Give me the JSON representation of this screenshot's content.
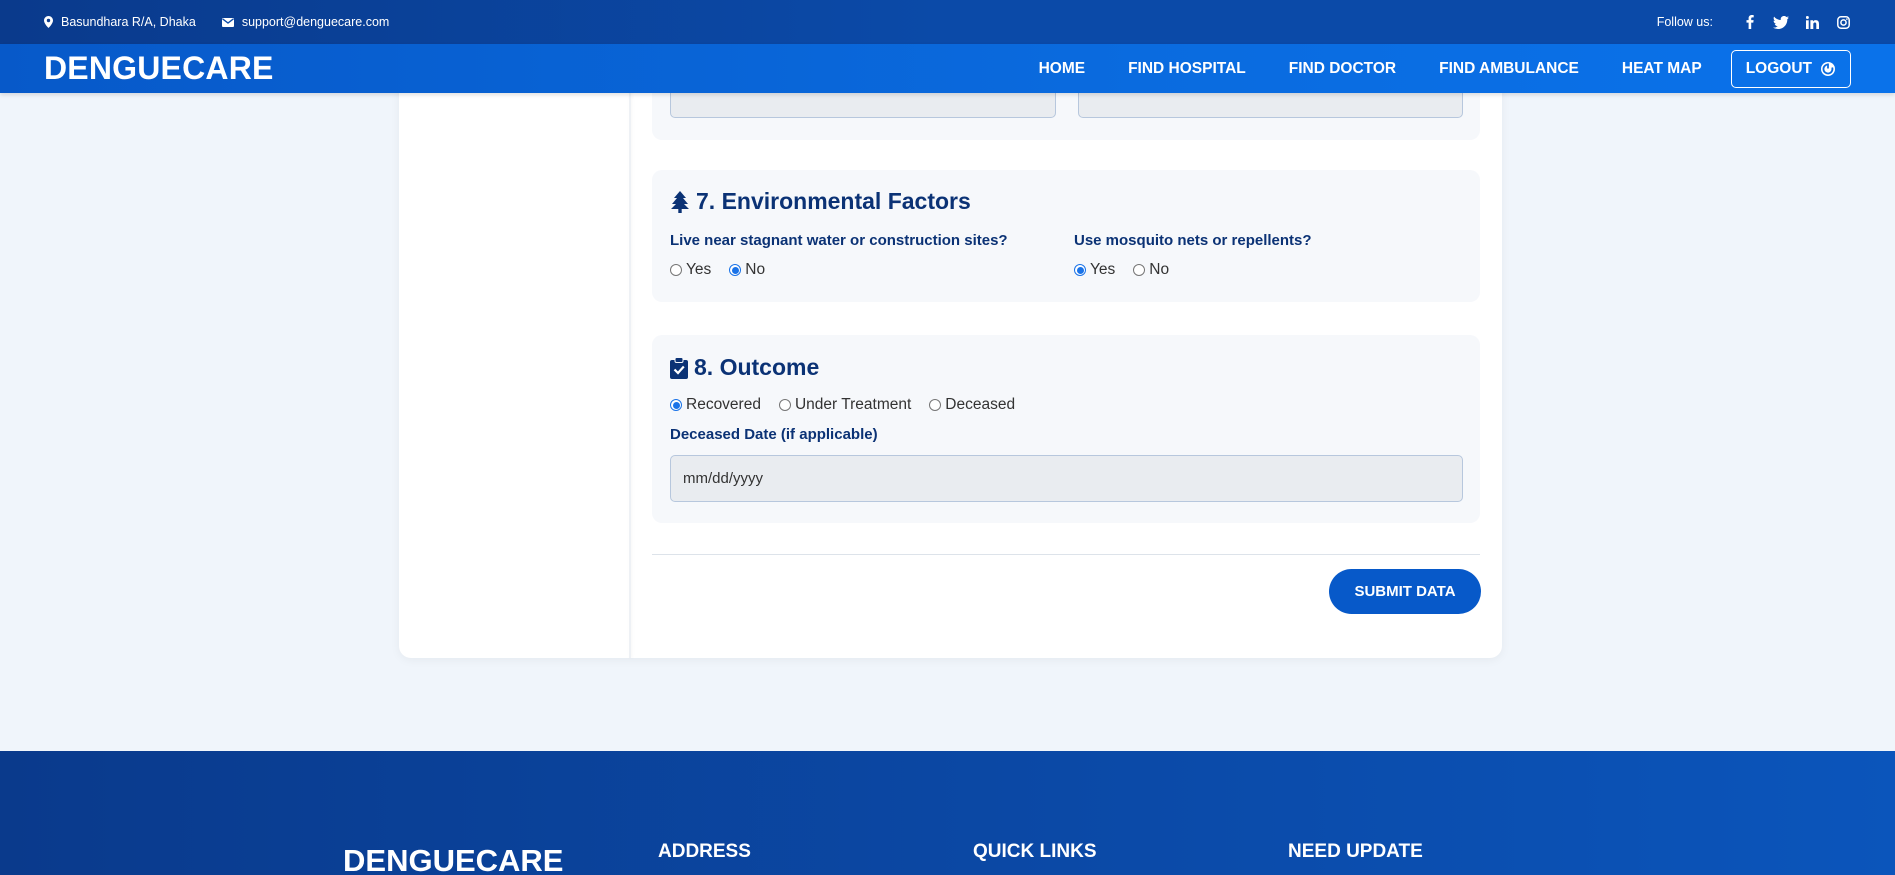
{
  "topbar": {
    "address": "Basundhara R/A, Dhaka",
    "email": "support@denguecare.com",
    "follow_label": "Follow us:",
    "socials": [
      "facebook-icon",
      "twitter-icon",
      "linkedin-icon",
      "instagram-icon"
    ]
  },
  "navbar": {
    "brand": "DENGUECARE",
    "links": [
      "HOME",
      "FIND HOSPITAL",
      "FIND DOCTOR",
      "FIND AMBULANCE",
      "HEAT MAP"
    ],
    "logout": "LOGOUT"
  },
  "section7": {
    "title": "7. Environmental Factors",
    "icon": "tree-icon",
    "q1": {
      "label": "Live near stagnant water or construction sites?",
      "options": [
        "Yes",
        "No"
      ],
      "selected": "No"
    },
    "q2": {
      "label": "Use mosquito nets or repellents?",
      "options": [
        "Yes",
        "No"
      ],
      "selected": "Yes"
    }
  },
  "section8": {
    "title": "8. Outcome",
    "icon": "clipboard-check-icon",
    "options": [
      "Recovered",
      "Under Treatment",
      "Deceased"
    ],
    "selected": "Recovered",
    "date_label": "Deceased Date (if applicable)",
    "date_placeholder": "mm/dd/yyyy"
  },
  "submit_label": "SUBMIT DATA",
  "footer": {
    "brand": "DENGUECARE",
    "headings": [
      "ADDRESS",
      "QUICK LINKS",
      "NEED UPDATE"
    ]
  },
  "colors": {
    "primary": "#0759c9",
    "dark_blue": "#0b3275",
    "radio_accent": "#1a73e8"
  }
}
